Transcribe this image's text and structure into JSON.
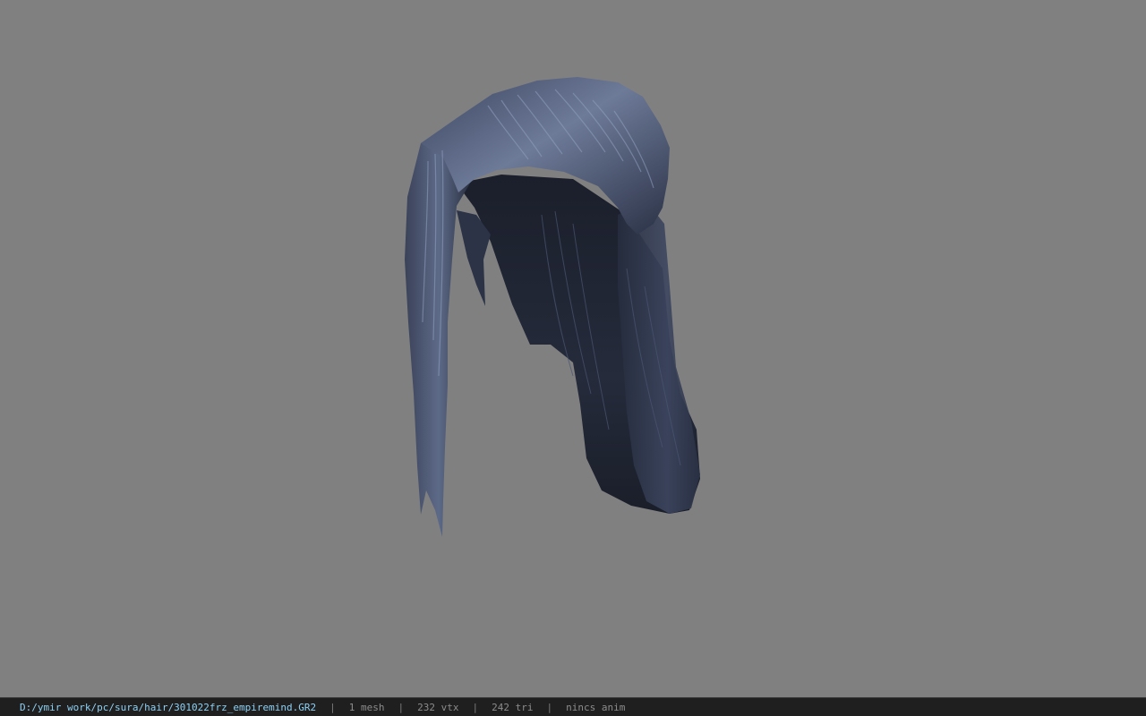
{
  "viewer": {
    "background_color": "#808080",
    "model": {
      "icon": "hair-mesh",
      "base_color": "#2b3243",
      "highlight_color": "#7d8aa8"
    }
  },
  "statusbar": {
    "file_path": "D:/ymir work/pc/sura/hair/301022frz_empiremind.GR2",
    "separator": "|",
    "mesh_count": "1 mesh",
    "vertex_count": "232 vtx",
    "triangle_count": "242 tri",
    "animation": "nincs anim",
    "path_color": "#8fd0f2"
  }
}
